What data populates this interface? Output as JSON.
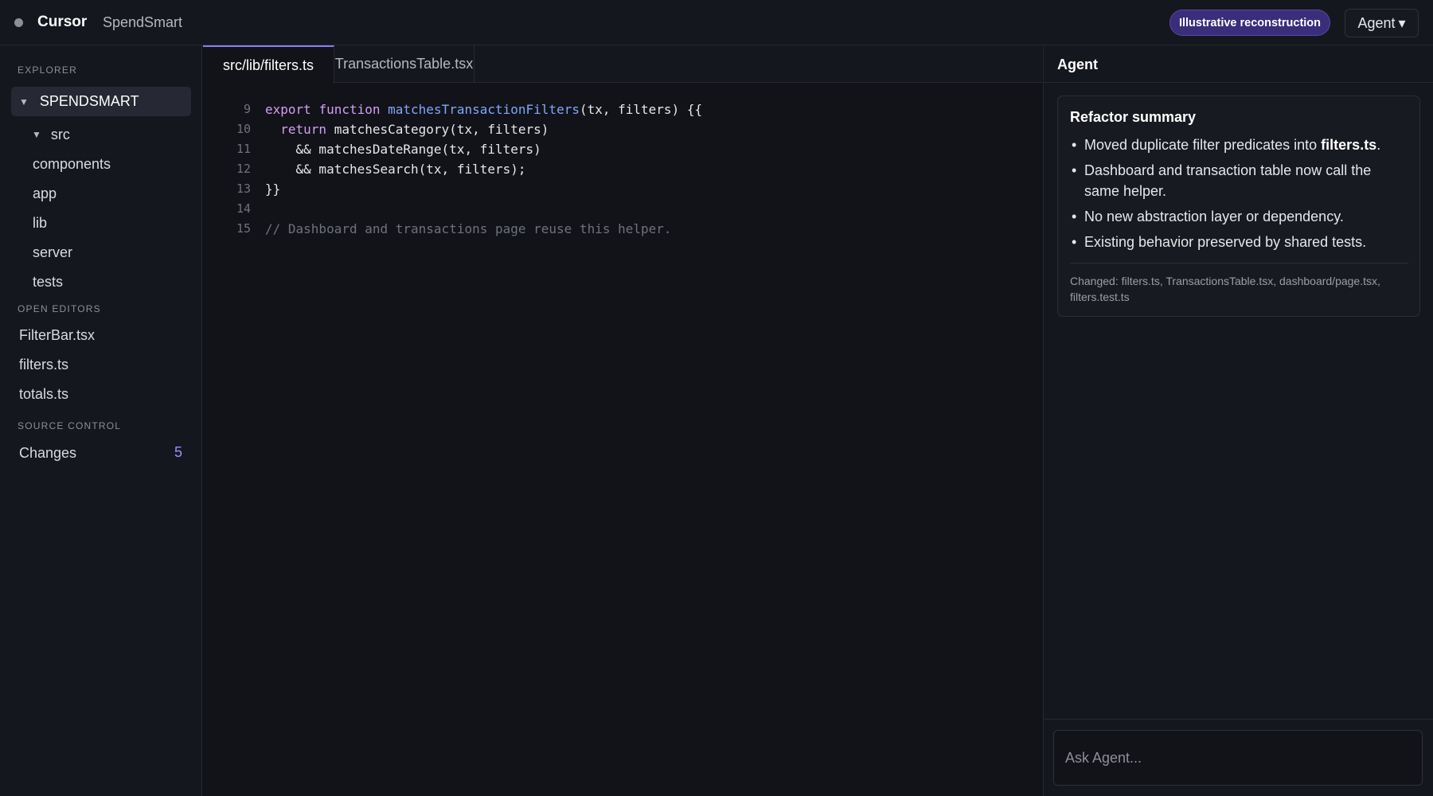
{
  "topbar": {
    "app_name": "Cursor",
    "project_name": "SpendSmart",
    "badge": "Illustrative reconstruction",
    "agent_menu": "Agent",
    "agent_menu_caret": "▾"
  },
  "sidebar": {
    "explorer_header": "EXPLORER",
    "root_folder": "SPENDSMART",
    "tree": [
      {
        "label": "src",
        "expanded": true
      },
      {
        "label": "components"
      },
      {
        "label": "app"
      },
      {
        "label": "lib"
      },
      {
        "label": "server"
      },
      {
        "label": "tests"
      }
    ],
    "open_editors_header": "OPEN EDITORS",
    "open_editors": [
      "FilterBar.tsx",
      "filters.ts",
      "totals.ts"
    ],
    "source_control_header": "SOURCE CONTROL",
    "changes_label": "Changes",
    "changes_count": "5"
  },
  "editor": {
    "tabs": [
      {
        "label": "src/lib/filters.ts",
        "active": true
      },
      {
        "label": "TransactionsTable.tsx",
        "active": false
      }
    ],
    "lines": [
      {
        "num": "9",
        "parts": [
          [
            "kw",
            "export"
          ],
          [
            "",
            " "
          ],
          [
            "kw",
            "function"
          ],
          [
            "",
            " "
          ],
          [
            "fn",
            "matchesTransactionFilters"
          ],
          [
            "",
            "(tx, filters) {{"
          ]
        ]
      },
      {
        "num": "10",
        "parts": [
          [
            "",
            "  "
          ],
          [
            "kw",
            "return"
          ],
          [
            "",
            " matchesCategory(tx, filters)"
          ]
        ]
      },
      {
        "num": "11",
        "parts": [
          [
            "",
            "    && matchesDateRange(tx, filters)"
          ]
        ]
      },
      {
        "num": "12",
        "parts": [
          [
            "",
            "    && matchesSearch(tx, filters);"
          ]
        ]
      },
      {
        "num": "13",
        "parts": [
          [
            "",
            "}}"
          ]
        ]
      },
      {
        "num": "14",
        "parts": []
      },
      {
        "num": "15",
        "parts": [
          [
            "cm",
            "// Dashboard and transactions page reuse this helper."
          ]
        ]
      }
    ]
  },
  "agent": {
    "title": "Agent",
    "summary_title": "Refactor summary",
    "bullets": [
      {
        "text": "Moved duplicate filter predicates into ",
        "bold": "filters.ts",
        "after": "."
      },
      {
        "text": "Dashboard and transaction table now call the same helper."
      },
      {
        "text": "No new abstraction layer or dependency."
      },
      {
        "text": "Existing behavior preserved by shared tests."
      }
    ],
    "changed_files": "Changed: filters.ts, TransactionsTable.tsx, dashboard/page.tsx, filters.test.ts",
    "ask_placeholder": "Ask Agent..."
  },
  "colors": {
    "accent": "#8b7cf6",
    "keyword": "#d49ef6",
    "function": "#7fa6ff",
    "comment": "#6e727c",
    "badge_bg": "#3a2d7a"
  }
}
